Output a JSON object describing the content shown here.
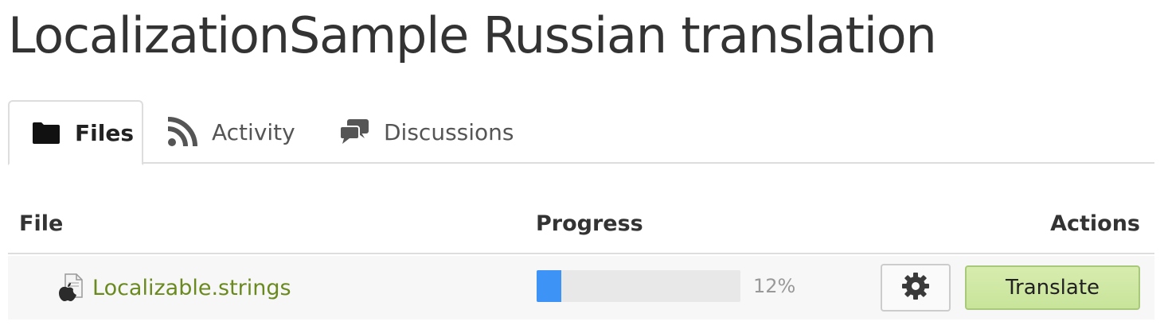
{
  "page": {
    "title": "LocalizationSample Russian translation"
  },
  "tabs": [
    {
      "label": "Files",
      "icon": "folder-icon",
      "active": true
    },
    {
      "label": "Activity",
      "icon": "rss-icon",
      "active": false
    },
    {
      "label": "Discussions",
      "icon": "comments-icon",
      "active": false
    }
  ],
  "table": {
    "columns": {
      "file": "File",
      "progress": "Progress",
      "actions": "Actions"
    },
    "rows": [
      {
        "file_name": "Localizable.strings",
        "file_icon": "apple-file-icon",
        "progress_percent": 12,
        "progress_text": "12%",
        "settings_icon": "gear-icon",
        "action_label": "Translate"
      }
    ]
  },
  "colors": {
    "link": "#6a8a1f",
    "progress_fill": "#3d94f6",
    "progress_track": "#e8e8e8",
    "translate_button": "#c8e49a"
  }
}
